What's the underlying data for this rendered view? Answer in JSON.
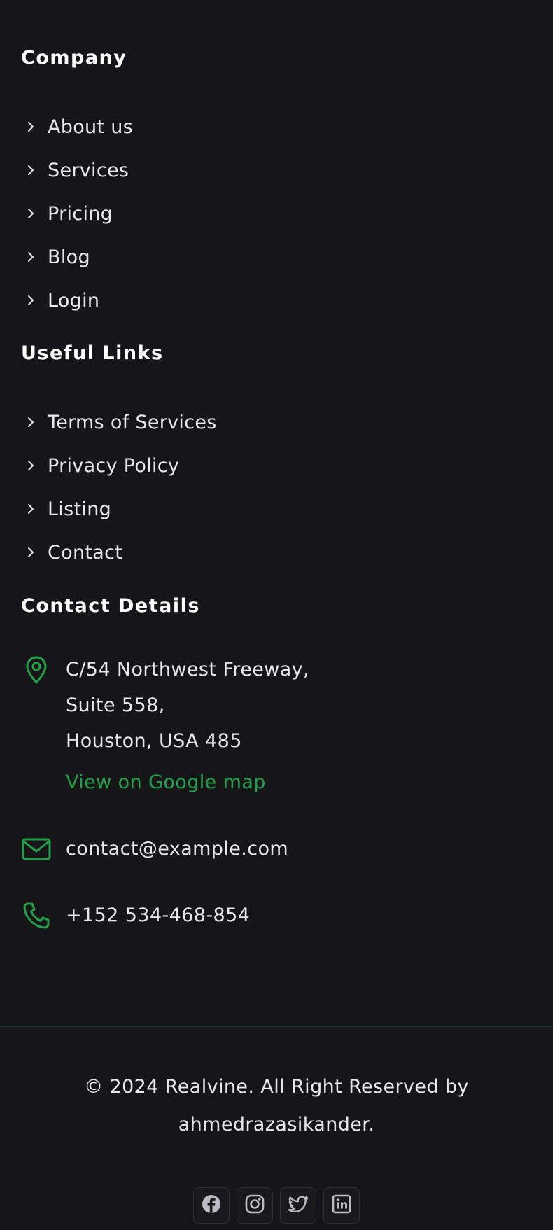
{
  "company": {
    "title": "Company",
    "items": [
      {
        "label": "About us"
      },
      {
        "label": "Services"
      },
      {
        "label": "Pricing"
      },
      {
        "label": "Blog"
      },
      {
        "label": "Login"
      }
    ]
  },
  "useful_links": {
    "title": "Useful Links",
    "items": [
      {
        "label": "Terms of Services"
      },
      {
        "label": "Privacy Policy"
      },
      {
        "label": "Listing"
      },
      {
        "label": "Contact"
      }
    ]
  },
  "contact": {
    "title": "Contact Details",
    "address_line1": "C/54 Northwest Freeway,",
    "address_line2": "Suite 558,",
    "address_line3": "Houston, USA 485",
    "map_link": "View on Google map",
    "email": "contact@example.com",
    "phone": "+152 534-468-854"
  },
  "footer": {
    "copyright_line1": "© 2024 Realvine. All Right Reserved by",
    "copyright_line2": "ahmedrazasikander.",
    "socials": [
      {
        "icon": "facebook-icon"
      },
      {
        "icon": "instagram-icon"
      },
      {
        "icon": "twitter-icon"
      },
      {
        "icon": "linkedin-icon"
      }
    ]
  },
  "colors": {
    "background": "#161618",
    "accent": "#22a04b",
    "divider": "#263039",
    "text": "#e8e8e8"
  }
}
